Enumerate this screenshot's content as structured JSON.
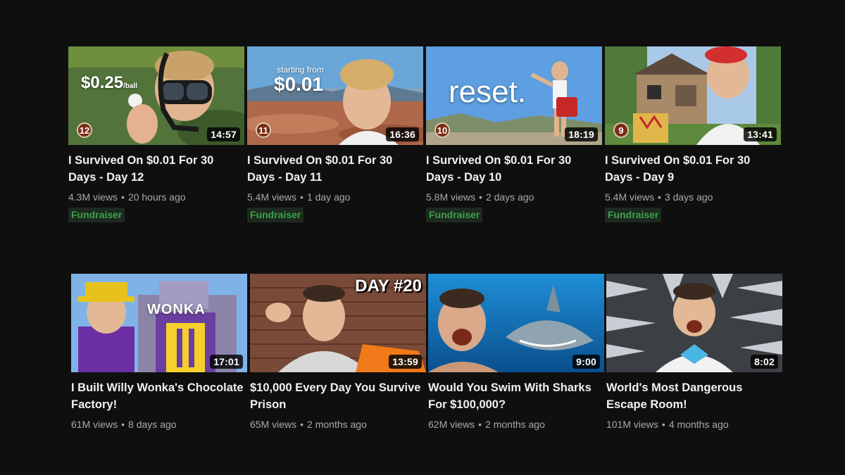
{
  "videos": [
    {
      "title": "I Survived On $0.01 For 30 Days - Day 12",
      "views": "4.3M views",
      "age": "20 hours ago",
      "duration": "14:57",
      "badge": "12",
      "overlay": "$0.25",
      "overlay_sub": "/ball",
      "fundraiser": "Fundraiser"
    },
    {
      "title": "I Survived On $0.01 For 30 Days - Day 11",
      "views": "5.4M views",
      "age": "1 day ago",
      "duration": "16:36",
      "badge": "11",
      "overlay_sub": "starting from",
      "overlay": "$0.01",
      "fundraiser": "Fundraiser"
    },
    {
      "title": "I Survived On $0.01 For 30 Days - Day 10",
      "views": "5.8M views",
      "age": "2 days ago",
      "duration": "18:19",
      "badge": "10",
      "overlay": "reset.",
      "fundraiser": "Fundraiser"
    },
    {
      "title": "I Survived On $0.01 For 30 Days - Day 9",
      "views": "5.4M views",
      "age": "3 days ago",
      "duration": "13:41",
      "badge": "9",
      "fundraiser": "Fundraiser"
    },
    {
      "title": "I Built Willy Wonka's Chocolate Factory!",
      "views": "61M views",
      "age": "8 days ago",
      "duration": "17:01",
      "overlay": "WONKA"
    },
    {
      "title": "$10,000 Every Day You Survive Prison",
      "views": "65M views",
      "age": "2 months ago",
      "duration": "13:59",
      "overlay": "DAY #20"
    },
    {
      "title": "Would You Swim With Sharks For $100,000?",
      "views": "62M views",
      "age": "2 months ago",
      "duration": "9:00"
    },
    {
      "title": "World's Most Dangerous Escape Room!",
      "views": "101M views",
      "age": "4 months ago",
      "duration": "8:02"
    }
  ],
  "colors": {
    "background": "#0f0f0f",
    "fundraiser_text": "#3ea04b",
    "meta_text": "#aaaaaa"
  }
}
